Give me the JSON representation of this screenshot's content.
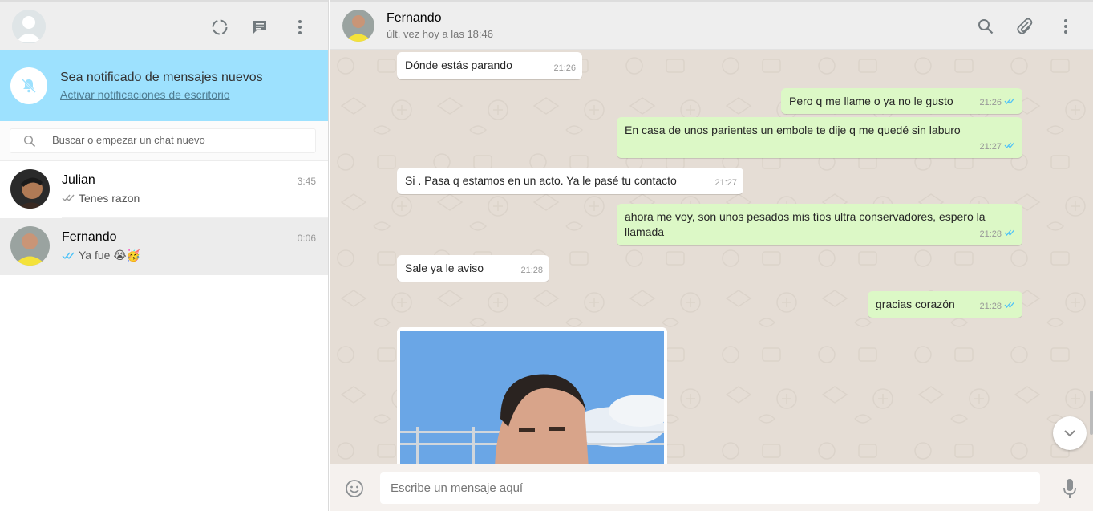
{
  "sidebar": {
    "notification": {
      "title": "Sea notificado de mensajes nuevos",
      "link": "Activar notificaciones de escritorio"
    },
    "search": {
      "placeholder": "Buscar o empezar un chat nuevo"
    },
    "chats": [
      {
        "name": "Julian",
        "time": "3:45",
        "last": "Tenes razon",
        "tick_color": "#9a9a9a"
      },
      {
        "name": "Fernando",
        "time": "0:06",
        "last": "Ya fue 😭🥳",
        "tick_color": "#4fc3f7"
      }
    ]
  },
  "conversation": {
    "contact_name": "Fernando",
    "status": "últ. vez hoy a las 18:46",
    "messages": [
      {
        "dir": "in",
        "text": "Dónde estás parando",
        "time": "21:26"
      },
      {
        "dir": "out",
        "text": "Pero q me llame o ya no le gusto",
        "time": "21:26"
      },
      {
        "dir": "out",
        "text": "En casa de unos parientes un embole te dije q me quedé sin laburo",
        "time": "21:27"
      },
      {
        "dir": "in",
        "text": "Si . Pasa q estamos en un acto. Ya le pasé tu contacto",
        "time": "21:27"
      },
      {
        "dir": "out",
        "text": "ahora me voy, son unos pesados mis tíos ultra conservadores, espero la llamada",
        "time": "21:28"
      },
      {
        "dir": "in",
        "text": "Sale ya le aviso",
        "time": "21:28"
      },
      {
        "dir": "out",
        "text": "gracias corazón",
        "time": "21:28"
      }
    ],
    "composer_placeholder": "Escribe un mensaje aquí"
  },
  "colors": {
    "notification_bg": "#9de1fe",
    "outgoing_bubble": "#dcf8c6",
    "incoming_bubble": "#ffffff",
    "read_tick": "#4fc3f7",
    "chat_bg": "#e5ddd5"
  },
  "icons": [
    "default-avatar-icon",
    "status-icon",
    "new-chat-icon",
    "menu-icon",
    "bell-off-icon",
    "search-icon",
    "double-tick-icon",
    "attach-icon",
    "emoji-icon",
    "mic-icon",
    "chevron-down-icon"
  ]
}
